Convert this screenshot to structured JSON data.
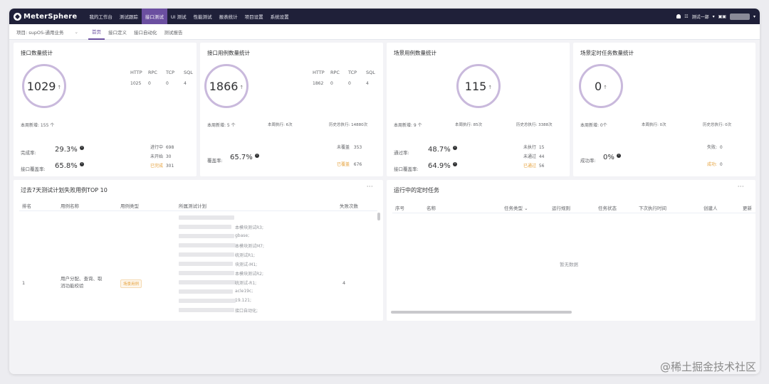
{
  "app": {
    "name": "MeterSphere",
    "nav": [
      "我的工作台",
      "测试跟踪",
      "接口测试",
      "UI 测试",
      "性能测试",
      "报表统计",
      "项目设置",
      "系统设置"
    ],
    "active_nav": 2,
    "workspace": "测试一部"
  },
  "subnav": {
    "project_label": "项目: supOS-通用业务",
    "tabs": [
      "首页",
      "接口定义",
      "接口自动化",
      "测试报告"
    ],
    "active_tab": 0
  },
  "cards": {
    "api": {
      "title": "接口数量统计",
      "total": "1029",
      "headers": [
        "HTTP",
        "RPC",
        "TCP",
        "SQL"
      ],
      "values": [
        "1025",
        "0",
        "0",
        "4"
      ],
      "new_week": "本周新增: 155 个",
      "complete_label": "完成率:",
      "complete_value": "29.3%",
      "coverage_label": "接口覆盖率:",
      "coverage_value": "65.8%",
      "status": [
        {
          "label": "进行中",
          "value": "698"
        },
        {
          "label": "未开始",
          "value": "30"
        },
        {
          "label": "已完成",
          "value": "301"
        }
      ]
    },
    "case": {
      "title": "接口用例数量统计",
      "total": "1866",
      "headers": [
        "HTTP",
        "RPC",
        "TCP",
        "SQL"
      ],
      "values": [
        "1862",
        "0",
        "0",
        "4"
      ],
      "new_week": "本周新增: 5 个",
      "exec_week": "本周执行: 6次",
      "exec_total": "历史总执行: 14880次",
      "coverage_label": "覆盖率:",
      "coverage_value": "65.7%",
      "status": [
        {
          "label": "未覆盖",
          "value": "353"
        },
        {
          "label": "已覆盖",
          "value": "676"
        }
      ]
    },
    "scenario": {
      "title": "场景用例数量统计",
      "total": "115",
      "new_week": "本周新增: 9 个",
      "exec_week": "本周执行: 85次",
      "exec_total": "历史总执行: 3388次",
      "pass_label": "通过率:",
      "pass_value": "48.7%",
      "coverage_label": "接口覆盖率:",
      "coverage_value": "64.9%",
      "status": [
        {
          "label": "未执行",
          "value": "15"
        },
        {
          "label": "未通过",
          "value": "44"
        },
        {
          "label": "已通过",
          "value": "56"
        }
      ]
    },
    "schedule": {
      "title": "场景定时任务数量统计",
      "total": "0",
      "new_week": "本周新增: 0个",
      "exec_week": "本周执行: 0次",
      "exec_total": "历史总执行: 0次",
      "success_label": "成功率:",
      "success_value": "0%",
      "status": [
        {
          "label": "失败:",
          "value": "0"
        },
        {
          "label": "成功:",
          "value": "0"
        }
      ]
    }
  },
  "failed_top": {
    "title": "过去7天测试计划失败用例TOP 10",
    "more": "···",
    "columns": [
      "排名",
      "用例名称",
      "用例类型",
      "所属测试计划",
      "失败次数"
    ],
    "row": {
      "rank": "1",
      "name_lines": [
        "用户分配、查询、取",
        "消功能校验"
      ],
      "type": "场景用例",
      "plan_lines": [
        "本模块测试R3;",
        "gbase;",
        "本模块测试M7;",
        "统测试R1;",
        "块测试-M1;",
        "本模块测试R2;",
        "统测试-R1;",
        "acle19c;",
        "19.121;",
        "接口自动化;"
      ],
      "fail_count": "4"
    }
  },
  "scheduled": {
    "title": "运行中的定时任务",
    "more": "···",
    "columns": [
      "序号",
      "名称",
      "任务类型",
      "运行规则",
      "任务状态",
      "下次执行时间",
      "创建人",
      "更新"
    ],
    "empty": "暂无数据"
  },
  "watermark": "@稀土掘金技术社区",
  "colors": {
    "topbar": "#1f2039",
    "accent": "#6b4fa0",
    "ring": "#c9b9dc",
    "warning": "#e6a23c"
  }
}
